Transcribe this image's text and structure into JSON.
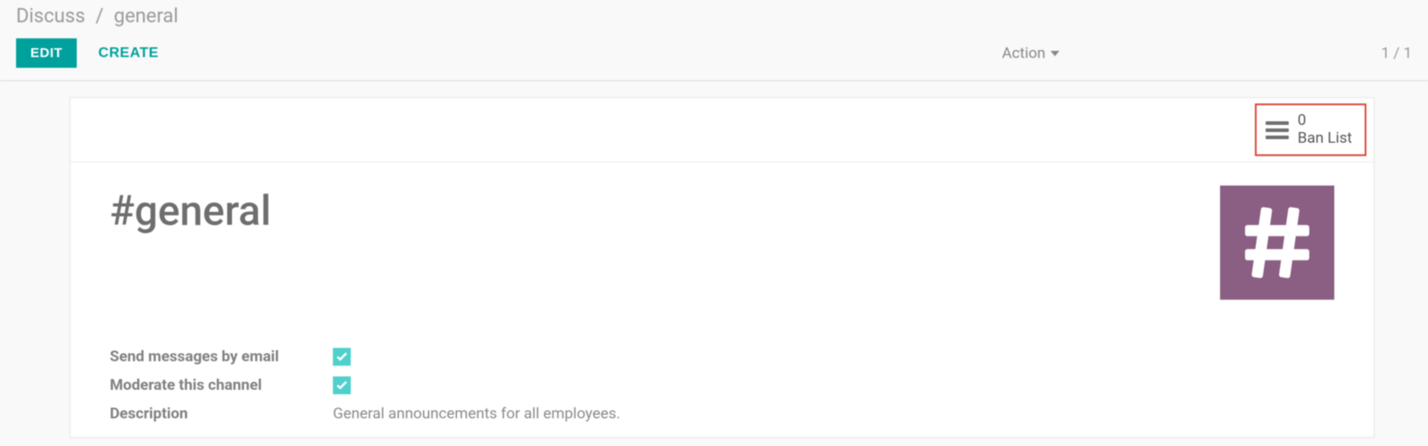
{
  "breadcrumb": {
    "root": "Discuss",
    "current": "general"
  },
  "toolbar": {
    "edit": "EDIT",
    "create": "CREATE",
    "action": "Action"
  },
  "pager": {
    "text": "1 / 1"
  },
  "stat": {
    "count": "0",
    "label": "Ban List"
  },
  "header": {
    "title": "#general"
  },
  "fields": {
    "send_email": {
      "label": "Send messages by email",
      "checked": true
    },
    "moderate": {
      "label": "Moderate this channel",
      "checked": true
    },
    "description": {
      "label": "Description",
      "value": "General announcements for all employees."
    }
  }
}
